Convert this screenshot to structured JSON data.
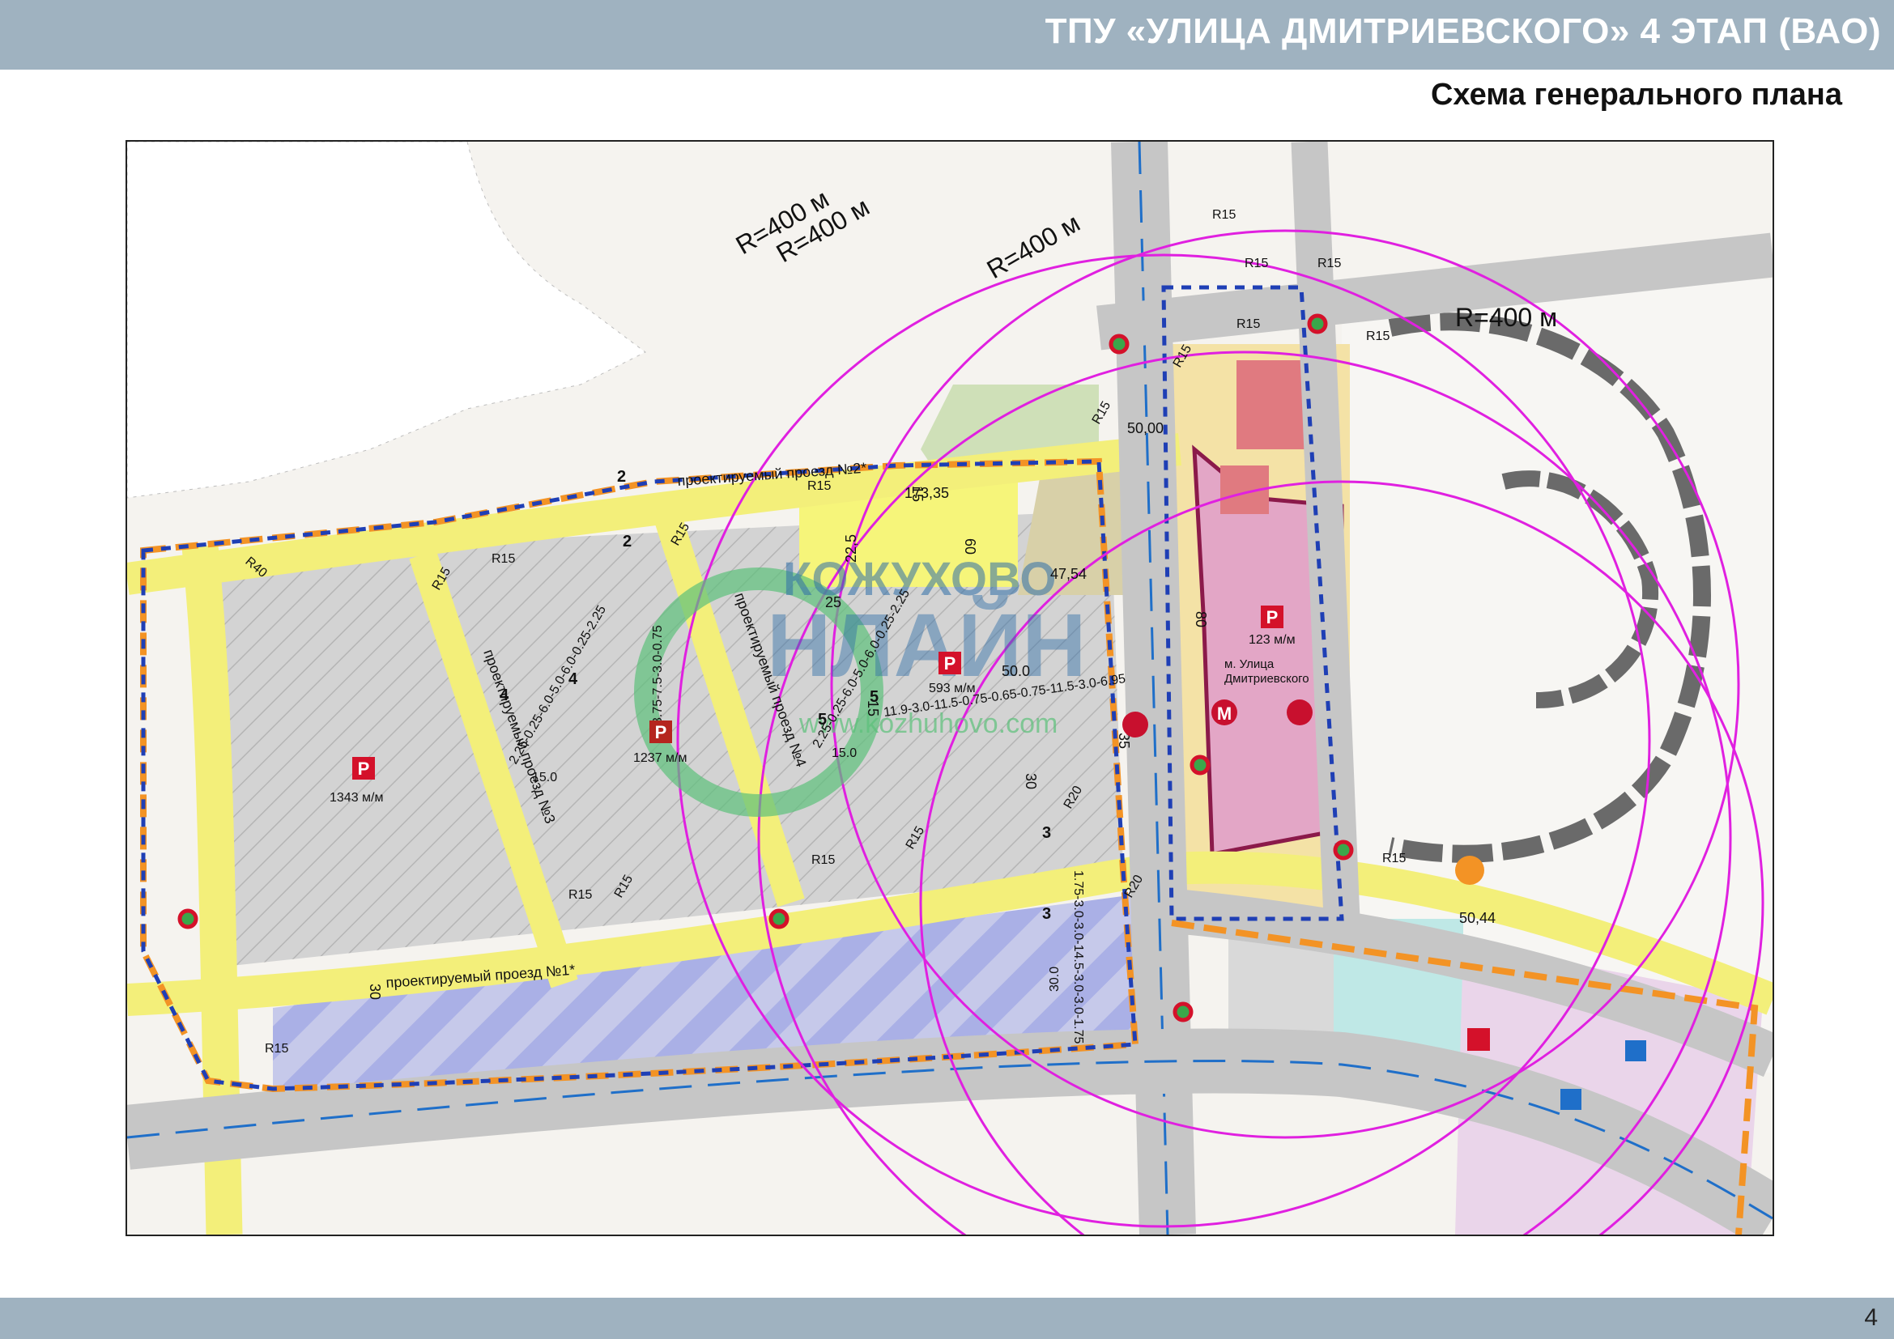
{
  "header": {
    "title": "ТПУ «УЛИЦА ДМИТРИЕВСКОГО» 4 ЭТАП (ВАО)",
    "subtitle": "Схема генерального плана"
  },
  "map": {
    "radius_labels": [
      "R=400 м",
      "R=400 м",
      "R=400 м",
      "R=400 м"
    ],
    "road_names": {
      "proezd_1": "проектируемый проезд №1*",
      "proezd_2": "проектируемый проезд №2*",
      "proezd_3": "проектируемый проезд №3",
      "proezd_4": "проектируемый проезд №4"
    },
    "dimensions": {
      "d17335": "173,35",
      "d60a": "60",
      "d225": "22,5",
      "d25": "25",
      "d4754": "47,54",
      "d5000": "50,00",
      "d5044": "50,44",
      "d80": "80",
      "d50": "50.0",
      "d30a": "30",
      "d30b": "30",
      "d35": "35",
      "d15a": "15",
      "d15b": "15"
    },
    "section_marks": [
      "2",
      "2",
      "3",
      "3",
      "4",
      "4",
      "5",
      "5"
    ],
    "curb_radii": [
      "R15",
      "R15",
      "R15",
      "R15",
      "R15",
      "R15",
      "R15",
      "R15",
      "R15",
      "R15",
      "R15",
      "R15",
      "R15",
      "R15",
      "R15",
      "R40",
      "R20",
      "R20",
      "R15",
      "R15"
    ],
    "profile_labels": {
      "p1": "2.25-0.25-6.0-5.0-6.0-0.25-2.25",
      "p2": "2.25-0.25-6.0-5.0-6.0-0.25-2.25",
      "p3": "11.9-3.0-11.5-0.75-0.65-0.75-11.5-3.0-6.95",
      "p4": "1.75-3.0-3.0-14.5-3.0-3.0-1.75",
      "p5": "3.75-7.5-3.0-0.75",
      "w15a": "15.0",
      "w15b": "15.0",
      "w30": "30.0"
    },
    "parking_lots": [
      {
        "symbol": "P",
        "capacity": "1343 м/м"
      },
      {
        "symbol": "P",
        "capacity": "1237 м/м"
      },
      {
        "symbol": "P",
        "capacity": "593 м/м"
      },
      {
        "symbol": "P",
        "capacity": "123 м/м"
      }
    ],
    "metro": {
      "symbol": "М",
      "station_name_line1": "м. Улица",
      "station_name_line2": "Дмитриевского"
    },
    "watermark": {
      "line1": "КОЖУХОВО",
      "line2": "НЛАЙН",
      "url": "www.kozhuhovo.com"
    },
    "colors": {
      "boundary_orange": "#f39325",
      "boundary_blue": "#1f3fb5",
      "radius_magenta": "#e020e0",
      "road_yellow": "#f3ef7a",
      "hatch_gray": "#c9c9c9",
      "parking_violet": "#b8bdf0",
      "metro_red": "#c8102e",
      "parking_symbol_red": "#d4112a",
      "blue_parking": "#1f6fc9"
    }
  },
  "footer": {
    "page_number": "4"
  }
}
